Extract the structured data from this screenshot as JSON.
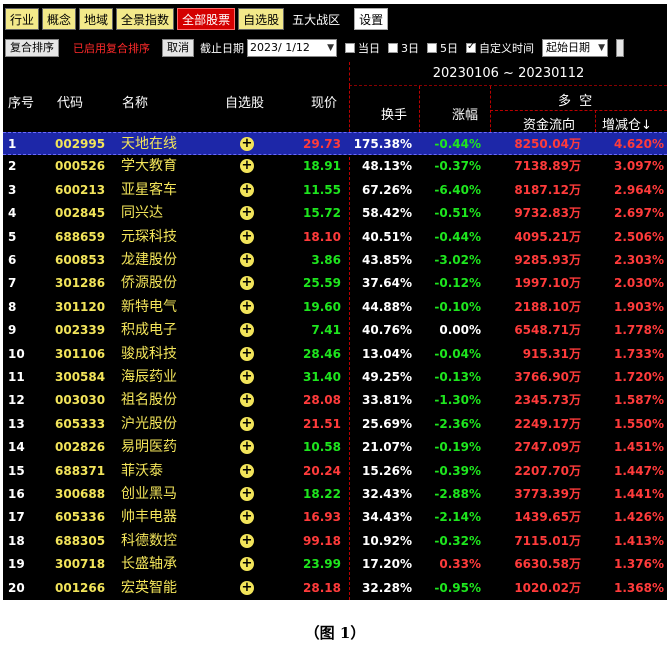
{
  "tabs": [
    {
      "label": "行业",
      "style": "normal"
    },
    {
      "label": "概念",
      "style": "normal"
    },
    {
      "label": "地域",
      "style": "normal"
    },
    {
      "label": "全景指数",
      "style": "normal"
    },
    {
      "label": "全部股票",
      "style": "active"
    },
    {
      "label": "自选股",
      "style": "normal"
    },
    {
      "label": "五大战区",
      "style": "plain"
    }
  ],
  "settings_label": "设置",
  "filter": {
    "sort_button": "复合排序",
    "sort_status": "已启用复合排序",
    "cancel_button": "取消",
    "end_date_label": "截止日期",
    "end_date_value": "2023/ 1/12",
    "options": [
      {
        "label": "当日",
        "checked": false
      },
      {
        "label": "3日",
        "checked": false
      },
      {
        "label": "5日",
        "checked": false
      },
      {
        "label": "自定义时间",
        "checked": true
      }
    ],
    "start_select_value": "起始日期"
  },
  "header": {
    "date_range": "20230106 ~ 20230112",
    "group_label": "多  空",
    "columns": {
      "index": "序号",
      "code": "代码",
      "name": "名称",
      "watch": "自选股",
      "price": "现价",
      "turnover": "换手",
      "change_pct": "涨幅",
      "capital_flow": "资金流向",
      "position_change": "增减仓↓"
    }
  },
  "rows": [
    {
      "idx": "1",
      "code": "002995",
      "name": "天地在线",
      "price": "29.73",
      "dir": "up",
      "turnover": "175.38%",
      "pct": "-0.44%",
      "flow": "8250.04万",
      "chg": "4.620%",
      "selected": true
    },
    {
      "idx": "2",
      "code": "000526",
      "name": "学大教育",
      "price": "18.91",
      "dir": "down",
      "turnover": "48.13%",
      "pct": "-0.37%",
      "flow": "7138.89万",
      "chg": "3.097%"
    },
    {
      "idx": "3",
      "code": "600213",
      "name": "亚星客车",
      "price": "11.55",
      "dir": "down",
      "turnover": "67.26%",
      "pct": "-6.40%",
      "flow": "8187.12万",
      "chg": "2.964%"
    },
    {
      "idx": "4",
      "code": "002845",
      "name": "同兴达",
      "price": "15.72",
      "dir": "down",
      "turnover": "58.42%",
      "pct": "-0.51%",
      "flow": "9732.83万",
      "chg": "2.697%"
    },
    {
      "idx": "5",
      "code": "688659",
      "name": "元琛科技",
      "price": "18.10",
      "dir": "up",
      "turnover": "40.51%",
      "pct": "-0.44%",
      "flow": "4095.21万",
      "chg": "2.506%"
    },
    {
      "idx": "6",
      "code": "600853",
      "name": "龙建股份",
      "price": "3.86",
      "dir": "down",
      "turnover": "43.85%",
      "pct": "-3.02%",
      "flow": "9285.93万",
      "chg": "2.303%"
    },
    {
      "idx": "7",
      "code": "301286",
      "name": "侨源股份",
      "price": "25.59",
      "dir": "down",
      "turnover": "37.64%",
      "pct": "-0.12%",
      "flow": "1997.10万",
      "chg": "2.030%"
    },
    {
      "idx": "8",
      "code": "301120",
      "name": "新特电气",
      "price": "19.60",
      "dir": "down",
      "turnover": "44.88%",
      "pct": "-0.10%",
      "flow": "2188.10万",
      "chg": "1.903%"
    },
    {
      "idx": "9",
      "code": "002339",
      "name": "积成电子",
      "price": "7.41",
      "dir": "down",
      "turnover": "40.76%",
      "pct": "0.00%",
      "flow": "6548.71万",
      "chg": "1.778%"
    },
    {
      "idx": "10",
      "code": "301106",
      "name": "骏成科技",
      "price": "28.46",
      "dir": "down",
      "turnover": "13.04%",
      "pct": "-0.04%",
      "flow": "915.31万",
      "chg": "1.733%"
    },
    {
      "idx": "11",
      "code": "300584",
      "name": "海辰药业",
      "price": "31.40",
      "dir": "down",
      "turnover": "49.25%",
      "pct": "-0.13%",
      "flow": "3766.90万",
      "chg": "1.720%"
    },
    {
      "idx": "12",
      "code": "003030",
      "name": "祖名股份",
      "price": "28.08",
      "dir": "up",
      "turnover": "33.81%",
      "pct": "-1.30%",
      "flow": "2345.73万",
      "chg": "1.587%"
    },
    {
      "idx": "13",
      "code": "605333",
      "name": "沪光股份",
      "price": "21.51",
      "dir": "up",
      "turnover": "25.69%",
      "pct": "-2.36%",
      "flow": "2249.17万",
      "chg": "1.550%"
    },
    {
      "idx": "14",
      "code": "002826",
      "name": "易明医药",
      "price": "10.58",
      "dir": "down",
      "turnover": "21.07%",
      "pct": "-0.19%",
      "flow": "2747.09万",
      "chg": "1.451%"
    },
    {
      "idx": "15",
      "code": "688371",
      "name": "菲沃泰",
      "price": "20.24",
      "dir": "up",
      "turnover": "15.26%",
      "pct": "-0.39%",
      "flow": "2207.70万",
      "chg": "1.447%"
    },
    {
      "idx": "16",
      "code": "300688",
      "name": "创业黑马",
      "price": "18.22",
      "dir": "down",
      "turnover": "32.43%",
      "pct": "-2.88%",
      "flow": "3773.39万",
      "chg": "1.441%"
    },
    {
      "idx": "17",
      "code": "605336",
      "name": "帅丰电器",
      "price": "16.93",
      "dir": "up",
      "turnover": "34.43%",
      "pct": "-2.14%",
      "flow": "1439.65万",
      "chg": "1.426%"
    },
    {
      "idx": "18",
      "code": "688305",
      "name": "科德数控",
      "price": "99.18",
      "dir": "up",
      "turnover": "10.92%",
      "pct": "-0.32%",
      "flow": "7115.01万",
      "chg": "1.413%"
    },
    {
      "idx": "19",
      "code": "300718",
      "name": "长盛轴承",
      "price": "23.99",
      "dir": "down",
      "turnover": "17.20%",
      "pct": "0.33%",
      "flow": "6630.58万",
      "chg": "1.376%"
    },
    {
      "idx": "20",
      "code": "001266",
      "name": "宏英智能",
      "price": "28.18",
      "dir": "up",
      "turnover": "32.28%",
      "pct": "-0.95%",
      "flow": "1020.02万",
      "chg": "1.368%"
    }
  ],
  "caption": "（图 1）",
  "colors": {
    "up": "#ff3b3b",
    "down": "#1ee61e",
    "stock_text": "#f2e45a",
    "selected_row": "#1d27a8"
  }
}
